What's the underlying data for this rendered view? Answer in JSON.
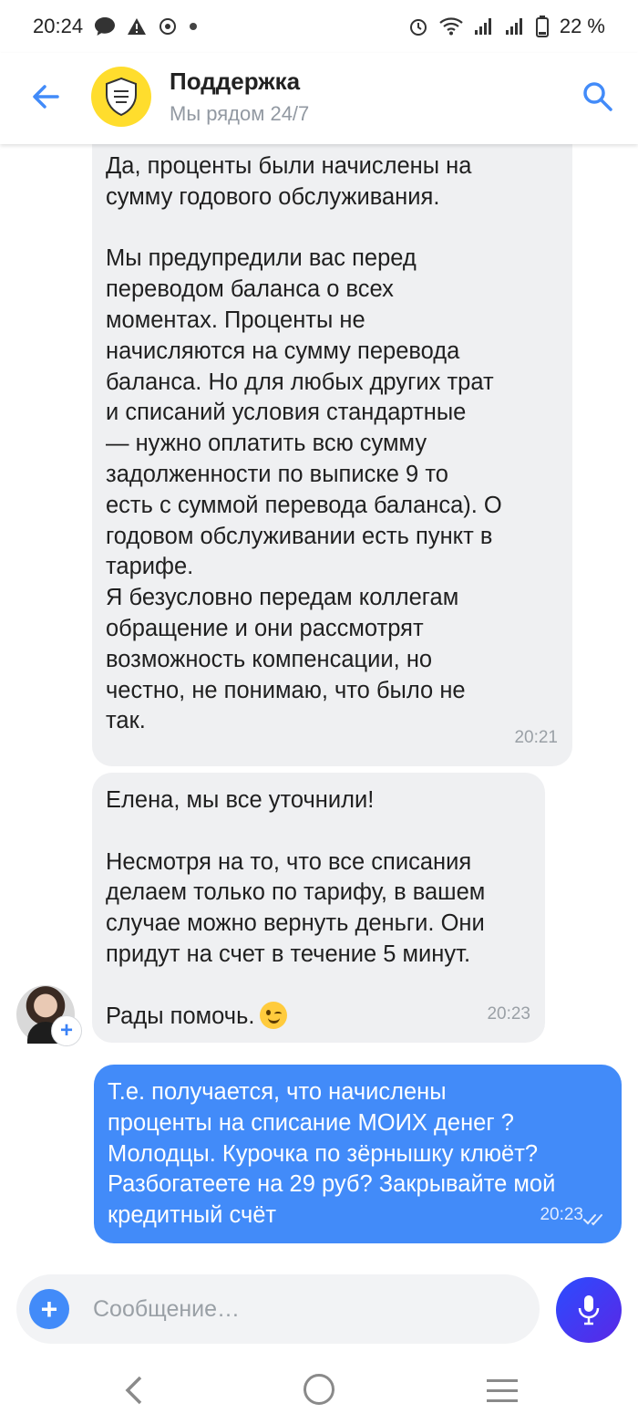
{
  "status_bar": {
    "time": "20:24",
    "battery": "22 %",
    "icons_left": [
      "message-icon",
      "warning-icon",
      "app-icon",
      "dot-icon"
    ],
    "icons_right": [
      "alarm-icon",
      "wifi-icon",
      "signal-icon",
      "signal-icon",
      "battery-icon"
    ]
  },
  "header": {
    "title": "Поддержка",
    "subtitle": "Мы рядом 24/7",
    "back_icon": "arrow-left-icon",
    "search_icon": "search-icon",
    "accent": "#428bf9",
    "logo_color": "#ffdd2d"
  },
  "messages": [
    {
      "author": "support",
      "text": "Да, проценты были начислены на\nсумму годового обслуживания.\n\nМы предупредили вас перед\nпереводом баланса о всех\nмоментах. Проценты не\nначисляются на сумму перевода\nбаланса. Но для любых других трат\nи списаний условия стандартные\n— нужно оплатить всю сумму\nзадолженности по выписке 9 то\nесть с суммой перевода баланса). О\nгодовом обслуживании есть пункт в\nтарифе.\nЯ безусловно передам коллегам\nобращение и они рассмотрят\nвозможность компенсации, но\nчестно, не понимаю, что было не\nтак.",
      "time": "20:21"
    },
    {
      "author": "support",
      "text": "Елена, мы все уточнили!\n\nНесмотря на то, что все списания\nделаем только по тарифу, в вашем\nслучае можно вернуть деньги. Они\nпридут на счет в течение 5 минут.\n\nРады помочь.",
      "emoji": "wink-emoji",
      "time": "20:23"
    },
    {
      "author": "user",
      "text": "Т.е. получается, что начислены\nпроценты на списание МОИХ денег ?\nМолодцы. Курочка по зёрнышку клюёт?\nРазбогатеете на 29 руб? Закрывайте мой\nкредитный счёт",
      "time": "20:23",
      "status_icon": "double-check-icon"
    }
  ],
  "composer": {
    "placeholder": "Сообщение…",
    "value": "",
    "attach_icon": "plus-icon",
    "mic_icon": "microphone-icon"
  },
  "nav": [
    "back-icon",
    "home-icon",
    "menu-icon"
  ]
}
